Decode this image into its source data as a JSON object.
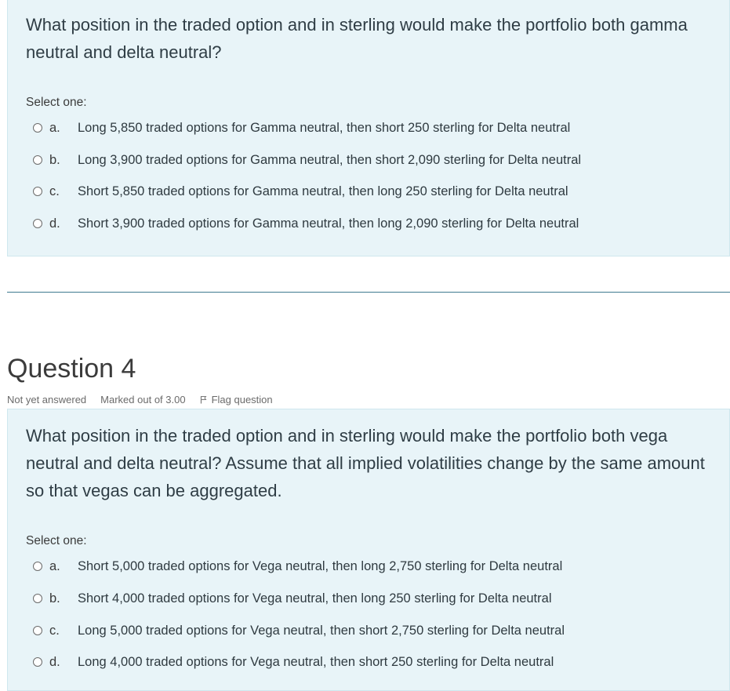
{
  "question3": {
    "text": "What position in the traded option and in sterling would make the portfolio both gamma neutral and delta neutral?",
    "select_label": "Select one:",
    "options": [
      {
        "letter": "a.",
        "text": "Long 5,850 traded options for Gamma neutral, then short 250 sterling for Delta neutral"
      },
      {
        "letter": "b.",
        "text": "Long 3,900 traded options for Gamma neutral, then short 2,090 sterling for Delta neutral"
      },
      {
        "letter": "c.",
        "text": "Short 5,850 traded options for Gamma neutral, then long 250 sterling for Delta neutral"
      },
      {
        "letter": "d.",
        "text": "Short 3,900 traded options for Gamma neutral, then long 2,090 sterling for Delta neutral"
      }
    ]
  },
  "question4": {
    "heading": "Question 4",
    "status": "Not yet answered",
    "marks": "Marked out of 3.00",
    "flag_label": "Flag question",
    "text": "What position in the traded option and in sterling would make the portfolio both vega neutral and delta neutral? Assume that all implied volatilities change by the same amount so that vegas can be aggregated.",
    "select_label": "Select one:",
    "options": [
      {
        "letter": "a.",
        "text": "Short 5,000 traded options for Vega neutral, then long 2,750 sterling for Delta neutral"
      },
      {
        "letter": "b.",
        "text": "Short 4,000 traded options for Vega neutral, then long 250 sterling for Delta neutral"
      },
      {
        "letter": "c.",
        "text": "Long 5,000 traded options for Vega neutral, then short 2,750 sterling for Delta neutral"
      },
      {
        "letter": "d.",
        "text": "Long 4,000 traded options for Vega neutral, then short 250 sterling for Delta neutral"
      }
    ]
  }
}
